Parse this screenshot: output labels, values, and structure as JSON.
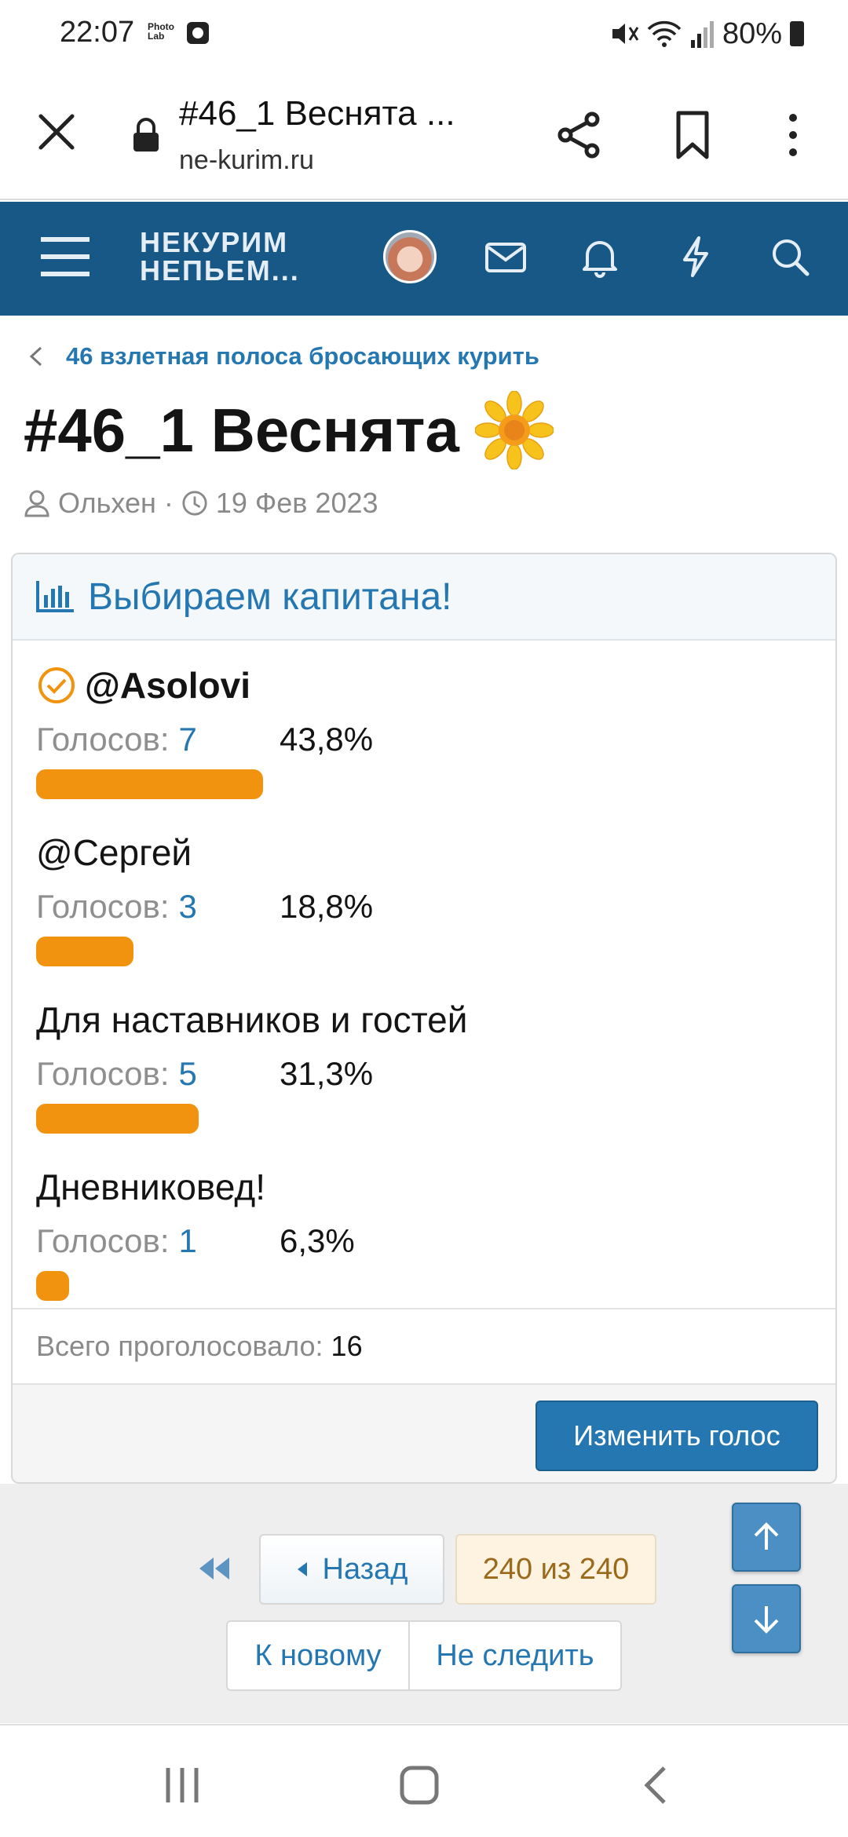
{
  "status_bar": {
    "time": "22:07",
    "app_label": "Photo Lab",
    "battery": "80%"
  },
  "browser": {
    "tab_title": "#46_1 Веснята ...",
    "domain": "ne-kurim.ru",
    "icons": [
      "close-icon",
      "lock-icon",
      "share-icon",
      "bookmark-icon",
      "more-icon"
    ]
  },
  "site_header": {
    "logo_line1": "НЕКУРИМ",
    "logo_line2": "НЕПЬЕМ...",
    "background": "#185886",
    "icons": [
      "menu-icon",
      "avatar",
      "mail-icon",
      "bell-icon",
      "lightning-icon",
      "search-icon"
    ]
  },
  "breadcrumb": {
    "label": "46 взлетная полоса бросающих курить"
  },
  "thread": {
    "title": "#46_1 Веснята",
    "author": "Ольхен",
    "separator": "·",
    "date": "19 Фев 2023"
  },
  "poll": {
    "title": "Выбираем капитана!",
    "votes_label": "Голосов:",
    "options": [
      {
        "name": "@Asolovi",
        "votes": "7",
        "percent": "43,8%",
        "fraction": 0.438,
        "selected": true
      },
      {
        "name": "@Сергей",
        "votes": "3",
        "percent": "18,8%",
        "fraction": 0.188,
        "selected": false
      },
      {
        "name": "Для наставников и гостей",
        "votes": "5",
        "percent": "31,3%",
        "fraction": 0.313,
        "selected": false
      },
      {
        "name": "Дневниковед!",
        "votes": "1",
        "percent": "6,3%",
        "fraction": 0.063,
        "selected": false
      }
    ],
    "total_label": "Всего проголосовало:",
    "total_value": "16",
    "change_vote_label": "Изменить голос",
    "bar_color": "#f2930f",
    "accent": "#2577b1"
  },
  "pagination": {
    "back_label": "Назад",
    "count_label": "240 из 240",
    "to_new_label": "К новому",
    "unwatch_label": "Не следить"
  }
}
